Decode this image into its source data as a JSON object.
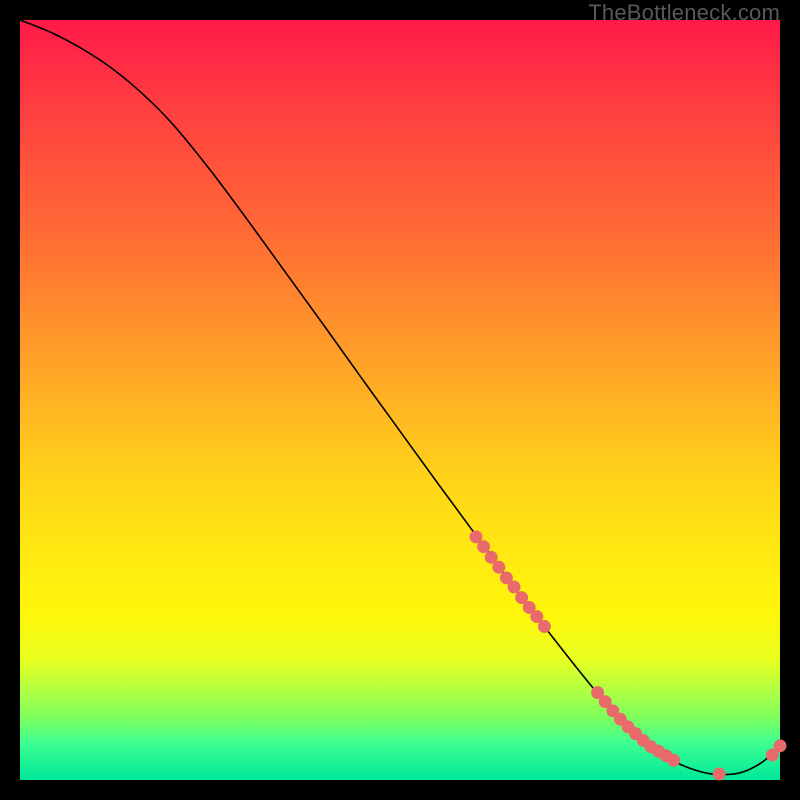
{
  "watermark": "TheBottleneck.com",
  "chart_data": {
    "type": "line",
    "title": "",
    "xlabel": "",
    "ylabel": "",
    "xlim": [
      0,
      100
    ],
    "ylim": [
      0,
      100
    ],
    "grid": false,
    "legend": false,
    "series": [
      {
        "name": "bottleneck-curve",
        "x": [
          0,
          4,
          8,
          12,
          16,
          20,
          25,
          30,
          35,
          40,
          45,
          50,
          55,
          60,
          65,
          70,
          75,
          80,
          82,
          85,
          88,
          91,
          94,
          96,
          98,
          100
        ],
        "y": [
          100.0,
          98.4,
          96.3,
          93.7,
          90.4,
          86.4,
          80.3,
          73.6,
          66.7,
          59.8,
          52.8,
          45.9,
          39.0,
          32.2,
          25.4,
          18.9,
          12.6,
          6.8,
          5.0,
          3.0,
          1.6,
          0.8,
          0.8,
          1.4,
          2.6,
          4.5
        ]
      }
    ],
    "markers": [
      {
        "name": "scatter-points",
        "x": [
          60,
          61,
          62,
          63,
          64,
          65,
          66,
          67,
          68,
          69,
          76,
          77,
          78,
          79,
          80,
          81,
          82,
          83,
          84,
          85,
          86,
          92,
          99,
          100
        ],
        "y": [
          32.0,
          30.7,
          29.3,
          28.0,
          26.6,
          25.4,
          24.0,
          22.7,
          21.5,
          20.2,
          11.5,
          10.3,
          9.1,
          8.0,
          7.0,
          6.1,
          5.2,
          4.4,
          3.8,
          3.2,
          2.6,
          0.8,
          3.3,
          4.5
        ]
      }
    ],
    "colors": {
      "line": "#000000",
      "marker": "#e86a6a"
    }
  }
}
